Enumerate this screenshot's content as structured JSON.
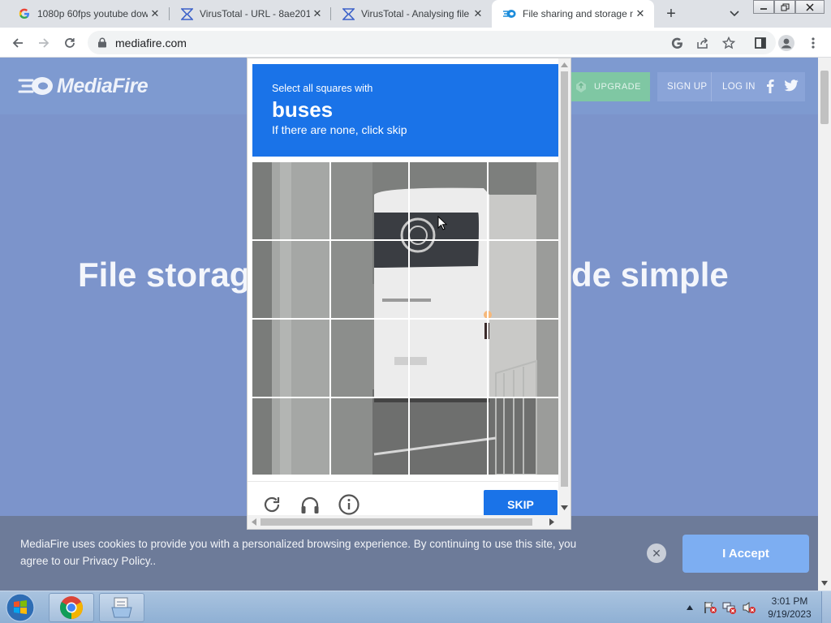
{
  "browser": {
    "tabs": [
      {
        "title": "1080p 60fps youtube dow",
        "favicon": "google-icon",
        "active": false
      },
      {
        "title": "VirusTotal - URL - 8ae201",
        "favicon": "virustotal-icon",
        "active": false
      },
      {
        "title": "VirusTotal - Analysing file",
        "favicon": "virustotal-icon",
        "active": false
      },
      {
        "title": "File sharing and storage m",
        "favicon": "mediafire-icon",
        "active": true
      }
    ],
    "new_tab_label": "+",
    "url": "mediafire.com"
  },
  "mediafire": {
    "logo_text": "MediaFire",
    "nav": {
      "upgrade": "UPGRADE",
      "sign_up": "SIGN UP",
      "log_in": "LOG IN"
    },
    "hero_left": "File storag",
    "hero_right": "de simple",
    "cookie": {
      "text": "MediaFire uses cookies to provide you with a personalized browsing experience. By continuing to use this site, you agree to our Privacy Policy..",
      "accept": "I Accept",
      "close": "✕"
    }
  },
  "captcha": {
    "instruction_line1": "Select all squares with",
    "target": "buses",
    "instruction_line3": "If there are none, click skip",
    "skip_label": "SKIP",
    "accent": "#1a73e8",
    "grid_size": "4x4"
  },
  "taskbar": {
    "time": "3:01 PM",
    "date": "9/19/2023",
    "pinned": [
      "chrome-icon",
      "file-explorer-icon"
    ]
  },
  "colors": {
    "page_overlay": "#7c94cb",
    "cookie_bar": "#6d7b99",
    "accept_button": "#7daef2",
    "upgrade_button": "#7fc7a3"
  }
}
